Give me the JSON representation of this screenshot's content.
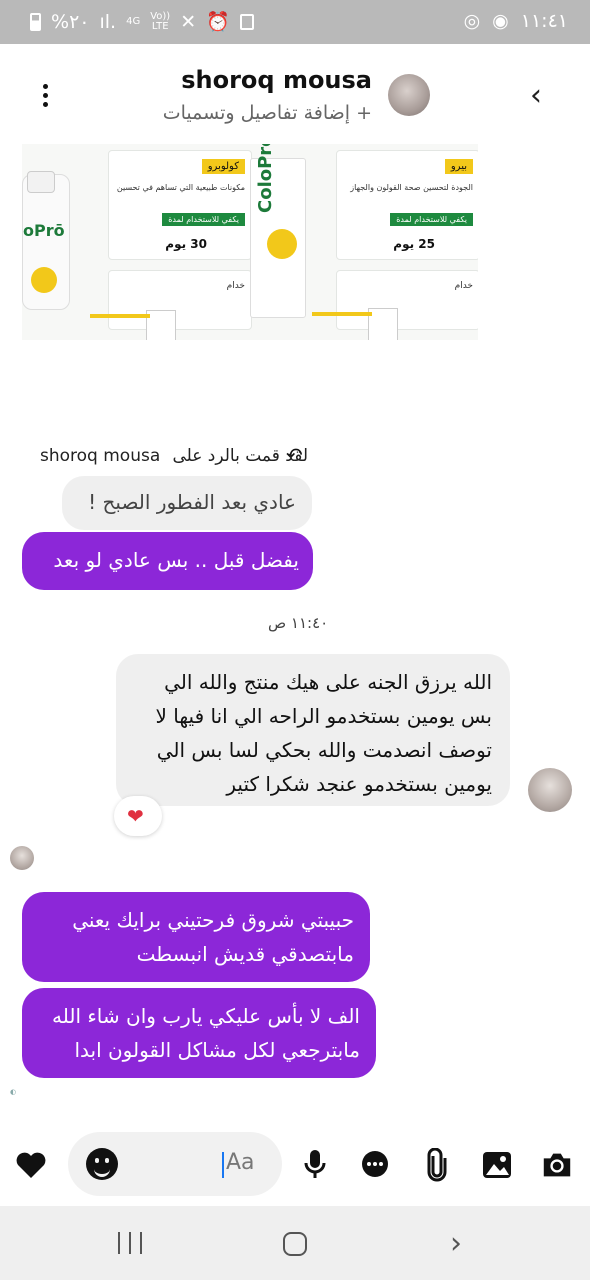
{
  "status_bar": {
    "battery_text": "%٢٠",
    "network_4g": "4G",
    "volte_top": "Vo))",
    "volte_bottom": "LTE",
    "time": "١١:٤١"
  },
  "header": {
    "contact_name": "shoroq mousa",
    "subtitle": "+ إضافة تفاصيل وتسميات",
    "back_icon": "chevron-left-icon",
    "menu_icon": "more-vertical-icon"
  },
  "product_image": {
    "brand_tag": "كولوبرو",
    "bottle_label": "oPrō",
    "card1_text": "مكونات طبيعية التي تساهم في تحسين",
    "card1_green": "يكفي للاستخدام لمدة",
    "card1_days": "30 يوم",
    "card2_tag": "بيرو",
    "card2_text": "الجودة لتحسين صحة القولون والجهاز",
    "card2_green": "يكفي للاستخدام لمدة",
    "card2_days": "25 يوم",
    "card3_text": "خدام",
    "card4_text": "خدام",
    "box_brand": "ColoPro"
  },
  "reply": {
    "label": "لقد قمت بالرد على",
    "name": "shoroq mousa",
    "quoted_text": "عادي بعد الفطور الصبح !"
  },
  "messages": {
    "out1": "يفضل قبل .. بس عادي لو بعد",
    "timestamp": "١١:٤٠ ص",
    "in1_lines": [
      "الله يرزق الجنه على هيك منتج والله الي",
      "بس يومين بستخدمو الراحه الي انا فيها لا",
      "توصف انصدمت والله بحكي لسا بس الي",
      "يومين بستخدمو عنجد شكرا كتير"
    ],
    "reaction": "❤",
    "out2_lines": [
      "حبيبتي شروق فرحتيني برايك يعني",
      "مابتصدقي قديش انبسطت"
    ],
    "out3_lines": [
      "الف لا بأس عليكي يارب وان شاء الله",
      "مابترجعي لكل مشاكل القولون ابدا"
    ]
  },
  "composer": {
    "placeholder": "Aa",
    "icons": [
      "camera-icon",
      "image-icon",
      "attachment-icon",
      "chat-bubble-icon",
      "microphone-icon",
      "emoji-icon",
      "heart-icon"
    ]
  },
  "colors": {
    "outgoing_bubble": "#8c27d8",
    "incoming_bubble": "#efefef",
    "status_bar": "#b9b9b9"
  }
}
